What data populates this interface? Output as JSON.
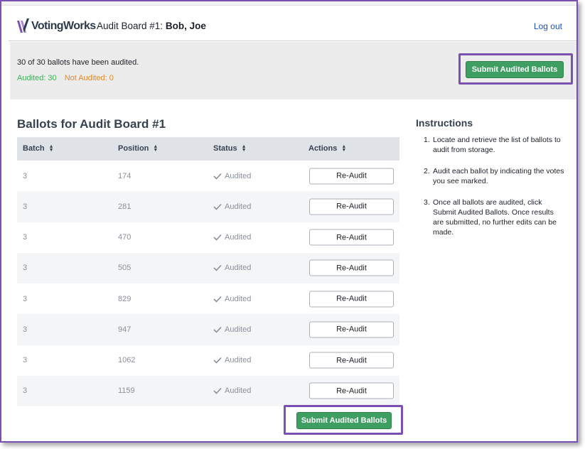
{
  "header": {
    "logo_text": "VotingWorks",
    "board_label": "Audit Board #1:",
    "board_members": "Bob, Joe",
    "logout_label": "Log out"
  },
  "banner": {
    "summary": "30 of 30 ballots have been audited.",
    "audited_label": "Audited: 30",
    "not_audited_label": "Not Audited: 0",
    "submit_label": "Submit Audited Ballots"
  },
  "ballots": {
    "title": "Ballots for Audit Board #1",
    "columns": [
      "Batch",
      "Position",
      "Status",
      "Actions"
    ],
    "rows": [
      {
        "batch": "3",
        "position": "174",
        "status": "Audited",
        "action": "Re-Audit"
      },
      {
        "batch": "3",
        "position": "281",
        "status": "Audited",
        "action": "Re-Audit"
      },
      {
        "batch": "3",
        "position": "470",
        "status": "Audited",
        "action": "Re-Audit"
      },
      {
        "batch": "3",
        "position": "505",
        "status": "Audited",
        "action": "Re-Audit"
      },
      {
        "batch": "3",
        "position": "829",
        "status": "Audited",
        "action": "Re-Audit"
      },
      {
        "batch": "3",
        "position": "947",
        "status": "Audited",
        "action": "Re-Audit"
      },
      {
        "batch": "3",
        "position": "1062",
        "status": "Audited",
        "action": "Re-Audit"
      },
      {
        "batch": "3",
        "position": "1159",
        "status": "Audited",
        "action": "Re-Audit"
      }
    ],
    "submit_label": "Submit Audited Ballots"
  },
  "instructions": {
    "title": "Instructions",
    "steps": [
      "Locate and retrieve the list of ballots to audit from storage.",
      "Audit each ballot by indicating the votes you see marked.",
      "Once all ballots are audited, click Submit Audited Ballots. Once results are submitted, no further edits can be made."
    ]
  },
  "icons": {
    "sort": "sort-icon",
    "check": "check-icon",
    "logo": "votingworks-logo-icon"
  },
  "colors": {
    "submit_green": "#3f9f62",
    "audited_green": "#3fae5a",
    "not_audited_orange": "#d9892d",
    "highlight_purple": "#7a51b2",
    "link_blue": "#1a4fb4"
  }
}
